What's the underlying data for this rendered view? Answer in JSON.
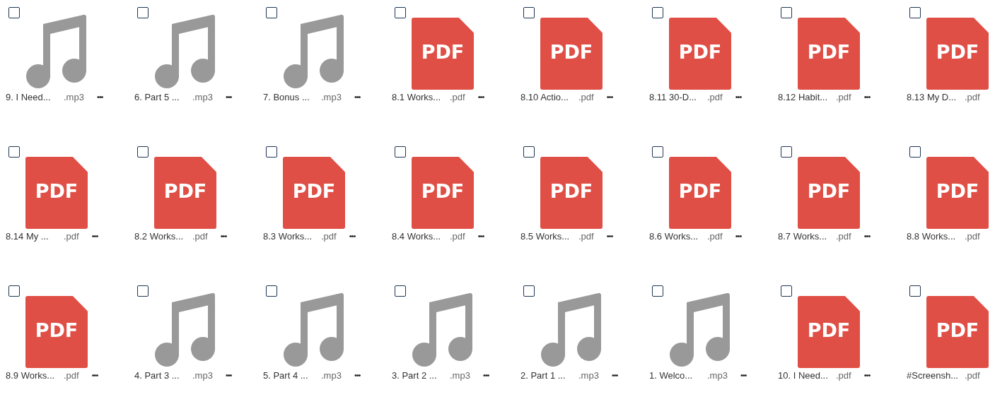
{
  "files": [
    {
      "kind": "audio",
      "name": "9. I Need...",
      "ext": ".mp3",
      "checked": false,
      "menu": "•••"
    },
    {
      "kind": "audio",
      "name": "6. Part 5 ...",
      "ext": ".mp3",
      "checked": false,
      "menu": "•••"
    },
    {
      "kind": "audio",
      "name": "7. Bonus ...",
      "ext": ".mp3",
      "checked": false,
      "menu": "•••"
    },
    {
      "kind": "pdf",
      "badge": "PDF",
      "name": "8.1 Works...",
      "ext": ".pdf",
      "checked": false,
      "menu": "•••"
    },
    {
      "kind": "pdf",
      "badge": "PDF",
      "name": "8.10 Actio...",
      "ext": ".pdf",
      "checked": false,
      "menu": "•••"
    },
    {
      "kind": "pdf",
      "badge": "PDF",
      "name": "8.11 30-D...",
      "ext": ".pdf",
      "checked": false,
      "menu": "•••"
    },
    {
      "kind": "pdf",
      "badge": "PDF",
      "name": "8.12 Habit...",
      "ext": ".pdf",
      "checked": false,
      "menu": "•••"
    },
    {
      "kind": "pdf",
      "badge": "PDF",
      "name": "8.13 My D...",
      "ext": ".pdf",
      "checked": false
    },
    {
      "kind": "pdf",
      "badge": "PDF",
      "name": "8.14 My ...",
      "ext": ".pdf",
      "checked": false,
      "menu": "•••"
    },
    {
      "kind": "pdf",
      "badge": "PDF",
      "name": "8.2 Works...",
      "ext": ".pdf",
      "checked": false,
      "menu": "•••"
    },
    {
      "kind": "pdf",
      "badge": "PDF",
      "name": "8.3 Works...",
      "ext": ".pdf",
      "checked": false,
      "menu": "•••"
    },
    {
      "kind": "pdf",
      "badge": "PDF",
      "name": "8.4 Works...",
      "ext": ".pdf",
      "checked": false,
      "menu": "•••"
    },
    {
      "kind": "pdf",
      "badge": "PDF",
      "name": "8.5 Works...",
      "ext": ".pdf",
      "checked": false,
      "menu": "•••"
    },
    {
      "kind": "pdf",
      "badge": "PDF",
      "name": "8.6 Works...",
      "ext": ".pdf",
      "checked": false,
      "menu": "•••"
    },
    {
      "kind": "pdf",
      "badge": "PDF",
      "name": "8.7 Works...",
      "ext": ".pdf",
      "checked": false,
      "menu": "•••"
    },
    {
      "kind": "pdf",
      "badge": "PDF",
      "name": "8.8 Works...",
      "ext": ".pdf",
      "checked": false
    },
    {
      "kind": "pdf",
      "badge": "PDF",
      "name": "8.9 Works...",
      "ext": ".pdf",
      "checked": false,
      "menu": "•••"
    },
    {
      "kind": "audio",
      "name": "4. Part 3 ...",
      "ext": ".mp3",
      "checked": false,
      "menu": "•••"
    },
    {
      "kind": "audio",
      "name": "5. Part 4 ...",
      "ext": ".mp3",
      "checked": false,
      "menu": "•••"
    },
    {
      "kind": "audio",
      "name": "3. Part 2 ...",
      "ext": ".mp3",
      "checked": false,
      "menu": "•••"
    },
    {
      "kind": "audio",
      "name": "2. Part 1 ...",
      "ext": ".mp3",
      "checked": false,
      "menu": "•••"
    },
    {
      "kind": "audio",
      "name": "1. Welco...",
      "ext": ".mp3",
      "checked": false,
      "menu": "•••"
    },
    {
      "kind": "pdf",
      "badge": "PDF",
      "name": "10. I Need...",
      "ext": ".pdf",
      "checked": false,
      "menu": "•••"
    },
    {
      "kind": "pdf",
      "badge": "PDF",
      "name": "#Screensh...",
      "ext": ".pdf",
      "checked": false
    }
  ]
}
